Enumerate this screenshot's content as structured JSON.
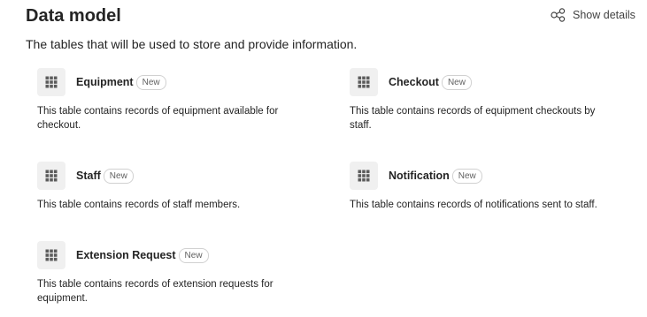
{
  "header": {
    "title": "Data model",
    "show_details_label": "Show details",
    "subtitle": "The tables that will be used to store and provide information."
  },
  "icons": {
    "show_details": "share-nodes-icon",
    "table": "table-grid-icon"
  },
  "tables": [
    {
      "name": "Equipment",
      "badge": "New",
      "description": "This table contains records of equipment available for checkout."
    },
    {
      "name": "Checkout",
      "badge": "New",
      "description": "This table contains records of equipment checkouts by staff."
    },
    {
      "name": "Staff",
      "badge": "New",
      "description": "This table contains records of staff members."
    },
    {
      "name": "Notification",
      "badge": "New",
      "description": "This table contains records of notifications sent to staff."
    },
    {
      "name": "Extension Request",
      "badge": "New",
      "description": "This table contains records of extension requests for equipment."
    }
  ]
}
